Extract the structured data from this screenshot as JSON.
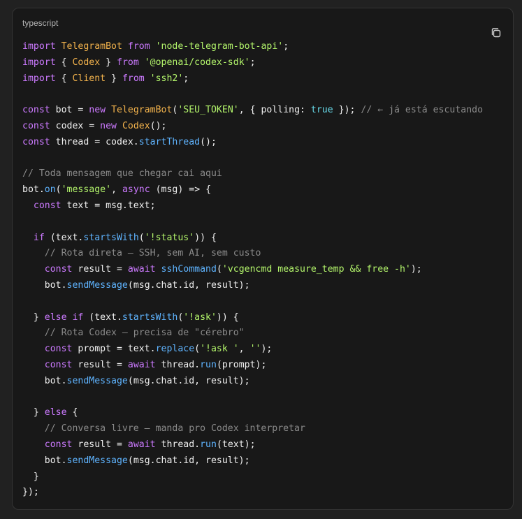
{
  "code_block": {
    "language": "typescript",
    "copy_icon": "copy-icon",
    "lines": [
      [
        {
          "k": "k",
          "v": "import"
        },
        {
          "k": "p",
          "v": " "
        },
        {
          "k": "t",
          "v": "TelegramBot"
        },
        {
          "k": "p",
          "v": " "
        },
        {
          "k": "k",
          "v": "from"
        },
        {
          "k": "p",
          "v": " "
        },
        {
          "k": "s",
          "v": "'node-telegram-bot-api'"
        },
        {
          "k": "p",
          "v": ";"
        }
      ],
      [
        {
          "k": "k",
          "v": "import"
        },
        {
          "k": "p",
          "v": " { "
        },
        {
          "k": "t",
          "v": "Codex"
        },
        {
          "k": "p",
          "v": " } "
        },
        {
          "k": "k",
          "v": "from"
        },
        {
          "k": "p",
          "v": " "
        },
        {
          "k": "s",
          "v": "'@openai/codex-sdk'"
        },
        {
          "k": "p",
          "v": ";"
        }
      ],
      [
        {
          "k": "k",
          "v": "import"
        },
        {
          "k": "p",
          "v": " { "
        },
        {
          "k": "t",
          "v": "Client"
        },
        {
          "k": "p",
          "v": " } "
        },
        {
          "k": "k",
          "v": "from"
        },
        {
          "k": "p",
          "v": " "
        },
        {
          "k": "s",
          "v": "'ssh2'"
        },
        {
          "k": "p",
          "v": ";"
        }
      ],
      [],
      [
        {
          "k": "k",
          "v": "const"
        },
        {
          "k": "p",
          "v": " bot = "
        },
        {
          "k": "k",
          "v": "new"
        },
        {
          "k": "p",
          "v": " "
        },
        {
          "k": "t",
          "v": "TelegramBot"
        },
        {
          "k": "p",
          "v": "("
        },
        {
          "k": "s",
          "v": "'SEU_TOKEN'"
        },
        {
          "k": "p",
          "v": ", { polling: "
        },
        {
          "k": "b",
          "v": "true"
        },
        {
          "k": "p",
          "v": " }); "
        },
        {
          "k": "c",
          "v": "// ← já está escutando"
        }
      ],
      [
        {
          "k": "k",
          "v": "const"
        },
        {
          "k": "p",
          "v": " codex = "
        },
        {
          "k": "k",
          "v": "new"
        },
        {
          "k": "p",
          "v": " "
        },
        {
          "k": "t",
          "v": "Codex"
        },
        {
          "k": "p",
          "v": "();"
        }
      ],
      [
        {
          "k": "k",
          "v": "const"
        },
        {
          "k": "p",
          "v": " thread = codex."
        },
        {
          "k": "f",
          "v": "startThread"
        },
        {
          "k": "p",
          "v": "();"
        }
      ],
      [],
      [
        {
          "k": "c",
          "v": "// Toda mensagem que chegar cai aqui"
        }
      ],
      [
        {
          "k": "p",
          "v": "bot."
        },
        {
          "k": "f",
          "v": "on"
        },
        {
          "k": "p",
          "v": "("
        },
        {
          "k": "s",
          "v": "'message'"
        },
        {
          "k": "p",
          "v": ", "
        },
        {
          "k": "k",
          "v": "async"
        },
        {
          "k": "p",
          "v": " (msg) => {"
        }
      ],
      [
        {
          "k": "p",
          "v": "  "
        },
        {
          "k": "k",
          "v": "const"
        },
        {
          "k": "p",
          "v": " text = msg.text;"
        }
      ],
      [],
      [
        {
          "k": "p",
          "v": "  "
        },
        {
          "k": "k",
          "v": "if"
        },
        {
          "k": "p",
          "v": " (text."
        },
        {
          "k": "f",
          "v": "startsWith"
        },
        {
          "k": "p",
          "v": "("
        },
        {
          "k": "s",
          "v": "'!status'"
        },
        {
          "k": "p",
          "v": ")) {"
        }
      ],
      [
        {
          "k": "p",
          "v": "    "
        },
        {
          "k": "c",
          "v": "// Rota direta — SSH, sem AI, sem custo"
        }
      ],
      [
        {
          "k": "p",
          "v": "    "
        },
        {
          "k": "k",
          "v": "const"
        },
        {
          "k": "p",
          "v": " result = "
        },
        {
          "k": "k",
          "v": "await"
        },
        {
          "k": "p",
          "v": " "
        },
        {
          "k": "f",
          "v": "sshCommand"
        },
        {
          "k": "p",
          "v": "("
        },
        {
          "k": "s",
          "v": "'vcgencmd measure_temp && free -h'"
        },
        {
          "k": "p",
          "v": ");"
        }
      ],
      [
        {
          "k": "p",
          "v": "    bot."
        },
        {
          "k": "f",
          "v": "sendMessage"
        },
        {
          "k": "p",
          "v": "(msg.chat.id, result);"
        }
      ],
      [],
      [
        {
          "k": "p",
          "v": "  } "
        },
        {
          "k": "k",
          "v": "else if"
        },
        {
          "k": "p",
          "v": " (text."
        },
        {
          "k": "f",
          "v": "startsWith"
        },
        {
          "k": "p",
          "v": "("
        },
        {
          "k": "s",
          "v": "'!ask'"
        },
        {
          "k": "p",
          "v": ")) {"
        }
      ],
      [
        {
          "k": "p",
          "v": "    "
        },
        {
          "k": "c",
          "v": "// Rota Codex — precisa de \"cérebro\""
        }
      ],
      [
        {
          "k": "p",
          "v": "    "
        },
        {
          "k": "k",
          "v": "const"
        },
        {
          "k": "p",
          "v": " prompt = text."
        },
        {
          "k": "f",
          "v": "replace"
        },
        {
          "k": "p",
          "v": "("
        },
        {
          "k": "s",
          "v": "'!ask '"
        },
        {
          "k": "p",
          "v": ", "
        },
        {
          "k": "s",
          "v": "''"
        },
        {
          "k": "p",
          "v": ");"
        }
      ],
      [
        {
          "k": "p",
          "v": "    "
        },
        {
          "k": "k",
          "v": "const"
        },
        {
          "k": "p",
          "v": " result = "
        },
        {
          "k": "k",
          "v": "await"
        },
        {
          "k": "p",
          "v": " thread."
        },
        {
          "k": "f",
          "v": "run"
        },
        {
          "k": "p",
          "v": "(prompt);"
        }
      ],
      [
        {
          "k": "p",
          "v": "    bot."
        },
        {
          "k": "f",
          "v": "sendMessage"
        },
        {
          "k": "p",
          "v": "(msg.chat.id, result);"
        }
      ],
      [],
      [
        {
          "k": "p",
          "v": "  } "
        },
        {
          "k": "k",
          "v": "else"
        },
        {
          "k": "p",
          "v": " {"
        }
      ],
      [
        {
          "k": "p",
          "v": "    "
        },
        {
          "k": "c",
          "v": "// Conversa livre — manda pro Codex interpretar"
        }
      ],
      [
        {
          "k": "p",
          "v": "    "
        },
        {
          "k": "k",
          "v": "const"
        },
        {
          "k": "p",
          "v": " result = "
        },
        {
          "k": "k",
          "v": "await"
        },
        {
          "k": "p",
          "v": " thread."
        },
        {
          "k": "f",
          "v": "run"
        },
        {
          "k": "p",
          "v": "(text);"
        }
      ],
      [
        {
          "k": "p",
          "v": "    bot."
        },
        {
          "k": "f",
          "v": "sendMessage"
        },
        {
          "k": "p",
          "v": "(msg.chat.id, result);"
        }
      ],
      [
        {
          "k": "p",
          "v": "  }"
        }
      ],
      [
        {
          "k": "p",
          "v": "});"
        }
      ]
    ]
  },
  "colors": {
    "background": "#212121",
    "card": "#181818",
    "keyword": "#cc7aff",
    "string": "#b3f56b",
    "comment": "#8a8a8a",
    "function": "#5fb4ff",
    "type": "#f2b24c",
    "boolean": "#66d9e8"
  }
}
